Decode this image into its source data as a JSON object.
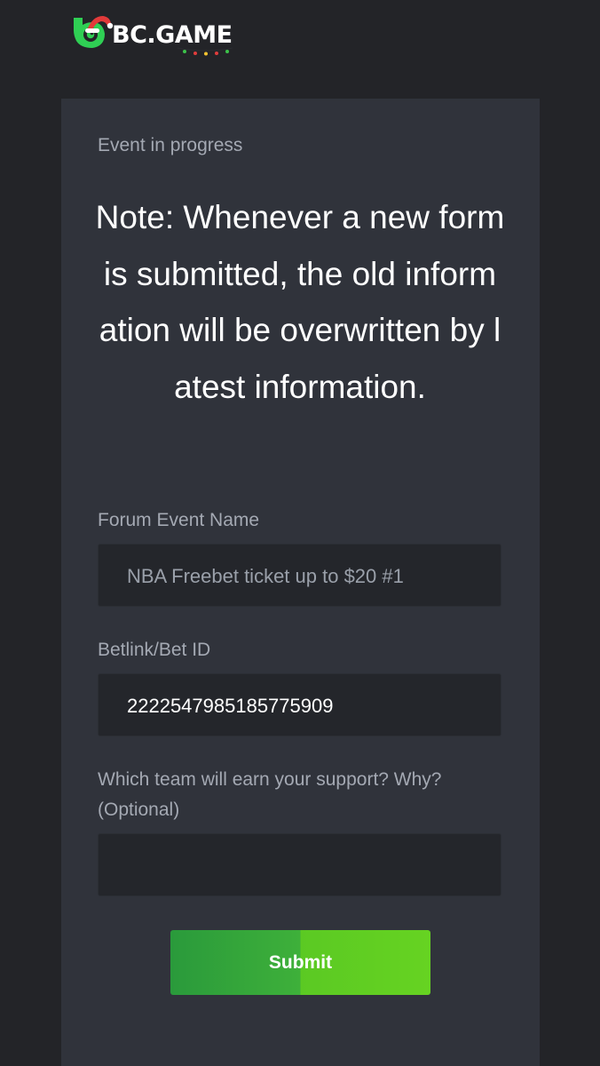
{
  "header": {
    "logo_text": "BC.GAME"
  },
  "form": {
    "status": "Event in progress",
    "note": "Note: Whenever a new form is submitted, the old information will be overwritten by latest information.",
    "fields": [
      {
        "label": "Forum Event Name",
        "value": "NBA Freebet ticket up to $20 #1",
        "state": "readonly"
      },
      {
        "label": "Betlink/Bet ID",
        "value": "2222547985185775909",
        "state": "filled"
      },
      {
        "label": "Which team will earn your support? Why?(Optional)",
        "value": "",
        "state": "empty"
      }
    ],
    "submit_label": "Submit"
  },
  "colors": {
    "background": "#232428",
    "card": "#30333b",
    "input": "#24262b",
    "label": "#a4a9b3",
    "accent_green": "#5bc923"
  },
  "icons": {
    "logo": "bc-game-logo-icon",
    "hat": "santa-hat-icon",
    "lights": "christmas-lights-icon"
  }
}
